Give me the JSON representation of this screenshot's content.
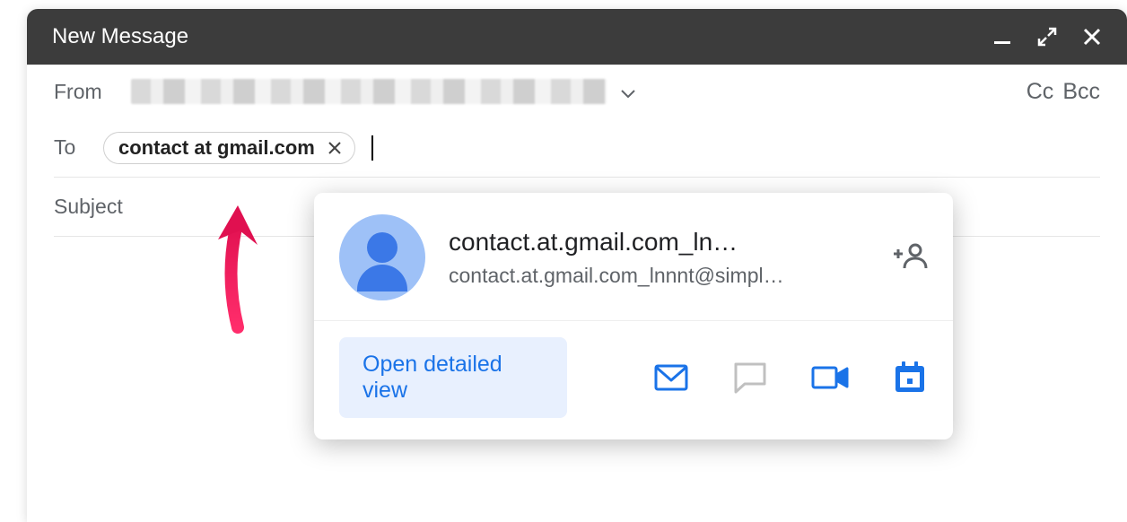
{
  "window": {
    "title": "New Message"
  },
  "from": {
    "label": "From"
  },
  "ccbcc": {
    "cc": "Cc",
    "bcc": "Bcc"
  },
  "to": {
    "label": "To",
    "chip_text": "contact at gmail.com"
  },
  "subject": {
    "label": "Subject"
  },
  "card": {
    "name": "contact.at.gmail.com_ln…",
    "email": "contact.at.gmail.com_lnnnt@simpl…",
    "open_detailed": "Open detailed view"
  }
}
